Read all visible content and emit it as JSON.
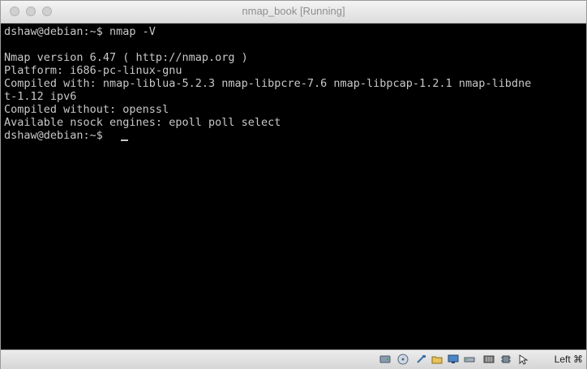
{
  "window": {
    "title": "nmap_book [Running]"
  },
  "terminal": {
    "lines": [
      "dshaw@debian:~$ nmap -V",
      "",
      "Nmap version 6.47 ( http://nmap.org )",
      "Platform: i686-pc-linux-gnu",
      "Compiled with: nmap-liblua-5.2.3 nmap-libpcre-7.6 nmap-libpcap-1.2.1 nmap-libdne",
      "t-1.12 ipv6",
      "Compiled without: openssl",
      "Available nsock engines: epoll poll select",
      "dshaw@debian:~$ "
    ]
  },
  "statusbar": {
    "icons": [
      "hard-disk-icon",
      "optical-drive-icon",
      "usb-icon",
      "shared-folder-icon",
      "display-icon",
      "network-icon",
      "recording-icon",
      "cpu-icon",
      "mouse-integration-icon"
    ],
    "host_key": "Left ⌘"
  },
  "colors": {
    "terminal_bg": "#000000",
    "terminal_fg": "#c8c8c8"
  }
}
